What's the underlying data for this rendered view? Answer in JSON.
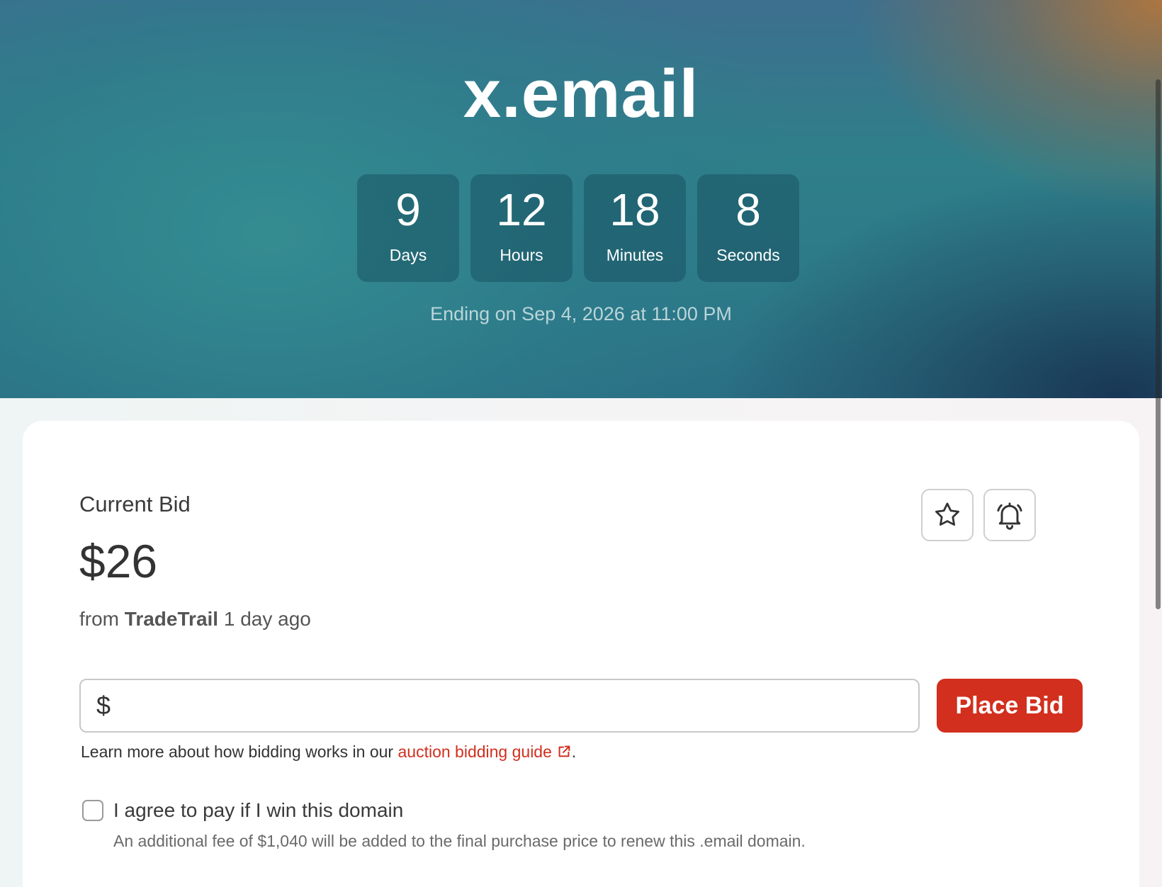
{
  "auction": {
    "domain": "x.email",
    "countdown": [
      {
        "value": "9",
        "label": "Days"
      },
      {
        "value": "12",
        "label": "Hours"
      },
      {
        "value": "18",
        "label": "Minutes"
      },
      {
        "value": "8",
        "label": "Seconds"
      }
    ],
    "ending_text": "Ending on Sep 4, 2026 at 11:00 PM"
  },
  "bid": {
    "current_label": "Current Bid",
    "current_amount": "$26",
    "from_prefix": "from",
    "bidder": "TradeTrail",
    "time_ago": "1 day ago",
    "currency_symbol": "$",
    "input_value": "",
    "place_bid_label": "Place Bid",
    "learn_more_prefix": "Learn more about how bidding works in our",
    "guide_link_text": "auction bidding guide",
    "learn_more_suffix": ".",
    "agree_label": "I agree to pay if I win this domain",
    "fee_note": "An additional fee of $1,040 will be added to the final purchase price to renew this .email domain."
  },
  "icons": {
    "watch": "star-icon",
    "alert": "bell-icon",
    "external": "external-link-icon"
  },
  "colors": {
    "accent": "#d22f1e",
    "hero_teal": "#2f7f8a",
    "hero_orange": "#b2763c",
    "hero_navy": "#183452"
  }
}
